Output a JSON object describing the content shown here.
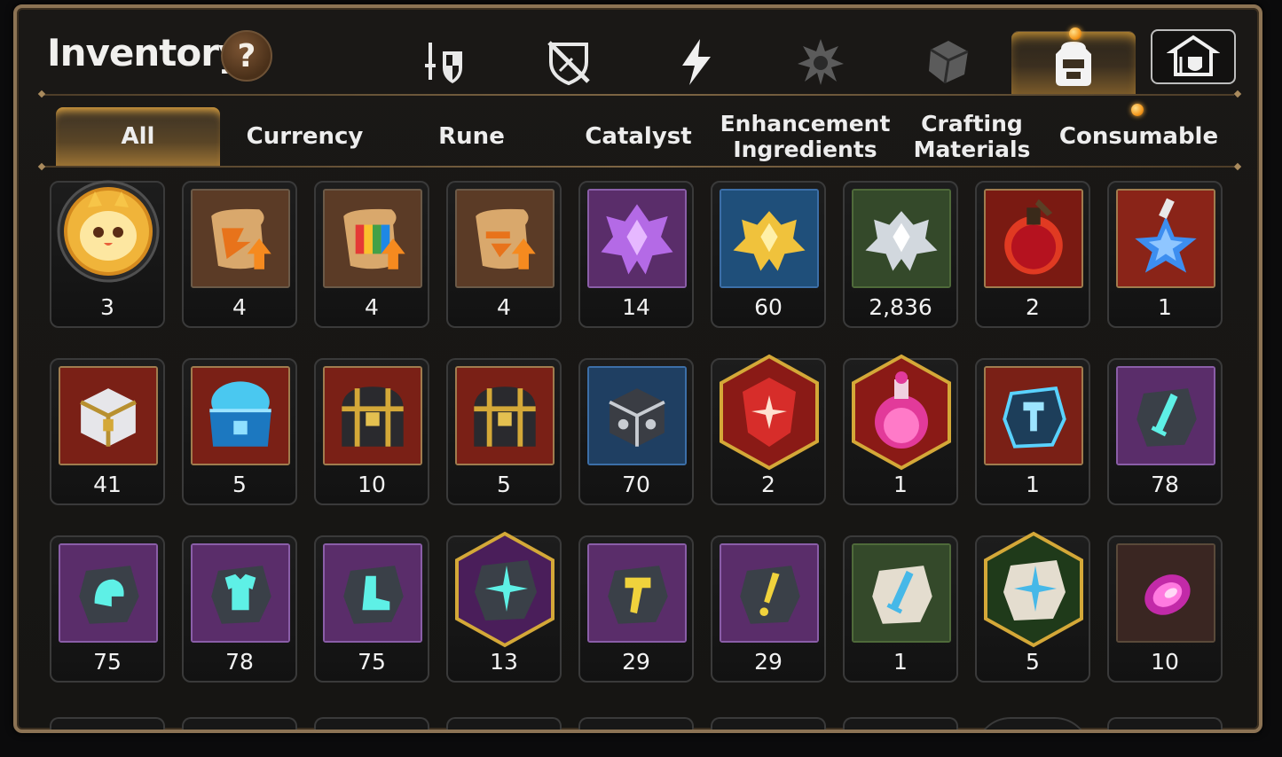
{
  "header": {
    "title": "Inventory",
    "help_label": "?"
  },
  "category_tabs": [
    {
      "name": "sword-shield-icon",
      "active": false
    },
    {
      "name": "broken-shield-icon",
      "active": false
    },
    {
      "name": "lightning-icon",
      "active": false
    },
    {
      "name": "gear-burst-icon",
      "active": false
    },
    {
      "name": "cube-icon",
      "active": false
    },
    {
      "name": "backpack-icon",
      "active": true
    },
    {
      "name": "guild-hall-icon",
      "active": false
    }
  ],
  "sub_tabs": [
    {
      "lines": [
        "All"
      ],
      "active": true
    },
    {
      "lines": [
        "Currency"
      ],
      "active": false
    },
    {
      "lines": [
        "Rune"
      ],
      "active": false
    },
    {
      "lines": [
        "Catalyst"
      ],
      "active": false
    },
    {
      "lines": [
        "Enhancement",
        "Ingredients"
      ],
      "active": false
    },
    {
      "lines": [
        "Crafting",
        "Materials"
      ],
      "active": false
    },
    {
      "lines": [
        "Consumable"
      ],
      "active": false
    }
  ],
  "items": [
    {
      "icon": "mascot-pet-icon",
      "count": "3"
    },
    {
      "icon": "upgrade-scroll-icon",
      "count": "4"
    },
    {
      "icon": "rainbow-scroll-icon",
      "count": "4"
    },
    {
      "icon": "upgrade-scroll-icon",
      "count": "4"
    },
    {
      "icon": "purple-crystal-icon",
      "count": "14"
    },
    {
      "icon": "gold-crystal-icon",
      "count": "60"
    },
    {
      "icon": "silver-crystal-icon",
      "count": "2,836"
    },
    {
      "icon": "red-potion-icon",
      "count": "2"
    },
    {
      "icon": "star-potion-icon",
      "count": "1"
    },
    {
      "icon": "silver-chest-icon",
      "count": "41"
    },
    {
      "icon": "blue-chest-icon",
      "count": "5"
    },
    {
      "icon": "gold-chest-icon",
      "count": "10"
    },
    {
      "icon": "gold-chest-icon",
      "count": "5"
    },
    {
      "icon": "steel-box-icon",
      "count": "70"
    },
    {
      "icon": "red-gem-icon",
      "count": "2"
    },
    {
      "icon": "pink-flask-icon",
      "count": "1"
    },
    {
      "icon": "hammer-rune-icon",
      "count": "1"
    },
    {
      "icon": "sword-stone-icon",
      "count": "78"
    },
    {
      "icon": "helmet-stone-icon",
      "count": "75"
    },
    {
      "icon": "armor-stone-icon",
      "count": "78"
    },
    {
      "icon": "boot-stone-icon",
      "count": "75"
    },
    {
      "icon": "star-stone-icon",
      "count": "13"
    },
    {
      "icon": "hammer-stone-icon",
      "count": "29"
    },
    {
      "icon": "exclaim-stone-icon",
      "count": "29"
    },
    {
      "icon": "white-sword-stone-icon",
      "count": "1"
    },
    {
      "icon": "white-star-stone-icon",
      "count": "5"
    },
    {
      "icon": "pink-orb-icon",
      "count": "10"
    }
  ],
  "colors": {
    "accent_gold": "#d39b37",
    "frame_border": "#8c7354",
    "text": "#f2f2f2"
  }
}
